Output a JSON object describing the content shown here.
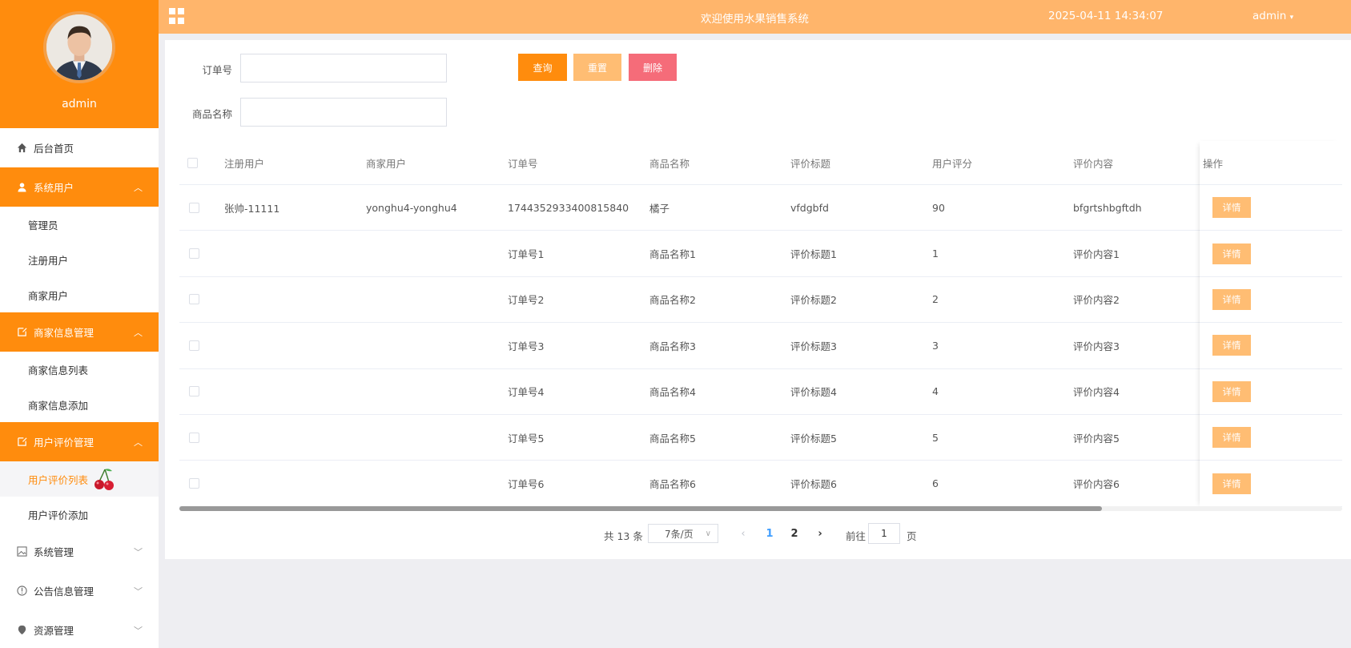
{
  "sidebar": {
    "username": "admin",
    "menu": [
      {
        "label": "后台首页"
      },
      {
        "label": "系统用户",
        "children": [
          "管理员",
          "注册用户",
          "商家用户"
        ]
      },
      {
        "label": "商家信息管理",
        "children": [
          "商家信息列表",
          "商家信息添加"
        ]
      },
      {
        "label": "用户评价管理",
        "children": [
          "用户评价列表",
          "用户评价添加"
        ]
      },
      {
        "label": "系统管理"
      },
      {
        "label": "公告信息管理"
      },
      {
        "label": "资源管理"
      }
    ]
  },
  "header": {
    "title": "欢迎使用水果销售系统",
    "datetime": "2025-04-11 14:34:07",
    "user": "admin"
  },
  "search": {
    "order_label": "订单号",
    "product_label": "商品名称",
    "order_value": "",
    "product_value": "",
    "query_button": "查询",
    "reset_button": "重置",
    "delete_button": "删除"
  },
  "table": {
    "columns": [
      "注册用户",
      "商家用户",
      "订单号",
      "商品名称",
      "评价标题",
      "用户评分",
      "评价内容",
      "操作"
    ],
    "rows": [
      [
        "张帅-11111",
        "yonghu4-yonghu4",
        "1744352933400815840",
        "橘子",
        "vfdgbfd",
        "90",
        "bfgrtshbgftdh"
      ],
      [
        "",
        "",
        "订单号1",
        "商品名称1",
        "评价标题1",
        "1",
        "评价内容1"
      ],
      [
        "",
        "",
        "订单号2",
        "商品名称2",
        "评价标题2",
        "2",
        "评价内容2"
      ],
      [
        "",
        "",
        "订单号3",
        "商品名称3",
        "评价标题3",
        "3",
        "评价内容3"
      ],
      [
        "",
        "",
        "订单号4",
        "商品名称4",
        "评价标题4",
        "4",
        "评价内容4"
      ],
      [
        "",
        "",
        "订单号5",
        "商品名称5",
        "评价标题5",
        "5",
        "评价内容5"
      ],
      [
        "",
        "",
        "订单号6",
        "商品名称6",
        "评价标题6",
        "6",
        "评价内容6"
      ]
    ],
    "detail_label": "详情"
  },
  "pagination": {
    "total": "共 13 条",
    "page_size": "7条/页",
    "pages": [
      "1",
      "2"
    ],
    "current": "1",
    "goto_prefix": "前往",
    "goto_value": "1",
    "goto_suffix": "页"
  },
  "colors": {
    "primary": "#ff8c0d",
    "topbar": "#ffb56b",
    "reset": "#ffbd73",
    "delete": "#f56c79",
    "page_active": "#409eff"
  }
}
